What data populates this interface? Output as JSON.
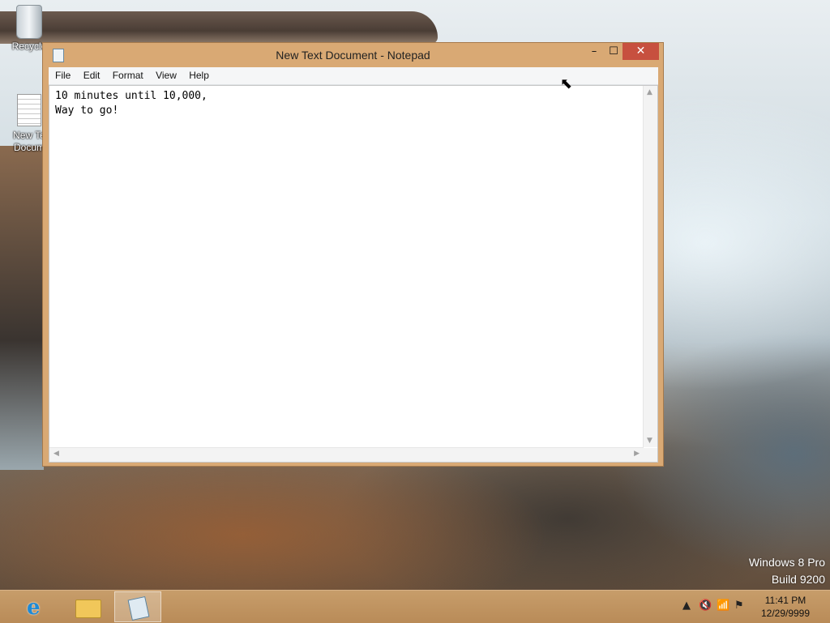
{
  "desktop": {
    "icons": [
      {
        "label": "Recycle",
        "name": "recycle-bin"
      },
      {
        "label": "New Te\nDocum",
        "name": "new-text-document"
      }
    ],
    "watermark": [
      "Windows 8 Pro",
      "Build 9200"
    ]
  },
  "notepad": {
    "title": "New Text Document - Notepad",
    "menu": [
      "File",
      "Edit",
      "Format",
      "View",
      "Help"
    ],
    "content": "10 minutes until 10,000,\nWay to go!",
    "controls": {
      "minimize": "–",
      "maximize": "☐",
      "close": "✕"
    }
  },
  "taskbar": {
    "pinned": [
      "internet-explorer",
      "file-explorer",
      "notepad"
    ],
    "tray": {
      "time": "11:41 PM",
      "date": "12/29/9999",
      "icons": [
        "show-hidden-icons",
        "volume-muted-icon",
        "network-icon",
        "action-center-flag-icon"
      ]
    }
  },
  "colors": {
    "window_frame": "#d9a974",
    "close_button": "#c7503f",
    "taskbar": "#c79d6a"
  }
}
